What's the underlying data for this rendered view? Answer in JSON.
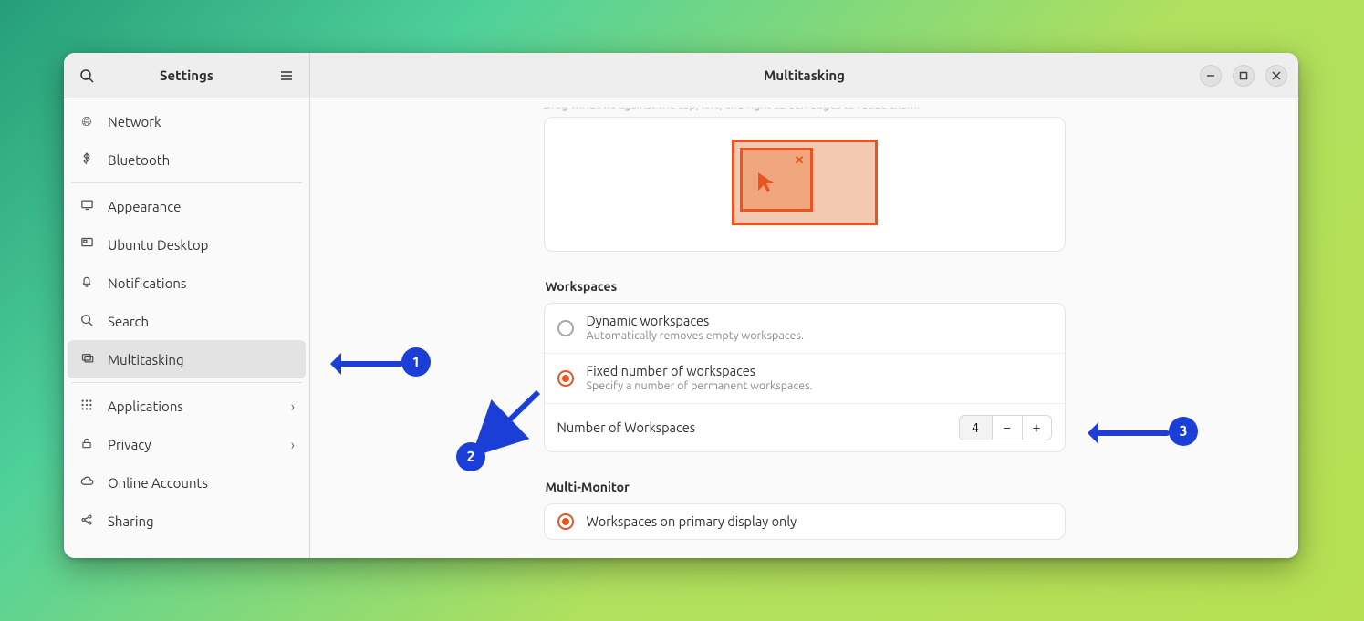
{
  "sidebar": {
    "title": "Settings",
    "items": [
      {
        "label": "Network",
        "glyph": "🌐"
      },
      {
        "label": "Bluetooth",
        "glyph": "ᛒ"
      },
      {
        "label": "Appearance",
        "glyph": "🖥"
      },
      {
        "label": "Ubuntu Desktop",
        "glyph": "▦"
      },
      {
        "label": "Notifications",
        "glyph": "🔔"
      },
      {
        "label": "Search",
        "glyph": "🔍"
      },
      {
        "label": "Multitasking",
        "glyph": "▭"
      },
      {
        "label": "Applications",
        "glyph": "⋮⋮⋮",
        "chevron": "›"
      },
      {
        "label": "Privacy",
        "glyph": "🔒",
        "chevron": "›"
      },
      {
        "label": "Online Accounts",
        "glyph": "☁"
      },
      {
        "label": "Sharing",
        "glyph": "↗"
      }
    ]
  },
  "header": {
    "title": "Multitasking"
  },
  "hotcorner": {
    "hint": "Drag windows against the top, left, and right screen edges to resize them."
  },
  "workspaces": {
    "section": "Workspaces",
    "dynamic": {
      "label": "Dynamic workspaces",
      "sub": "Automatically removes empty workspaces."
    },
    "fixed": {
      "label": "Fixed number of workspaces",
      "sub": "Specify a number of permanent workspaces."
    },
    "count_label": "Number of Workspaces",
    "count_value": "4"
  },
  "multi": {
    "section": "Multi-Monitor",
    "primary_only": "Workspaces on primary display only"
  },
  "annotations": {
    "a1": "1",
    "a2": "2",
    "a3": "3"
  }
}
